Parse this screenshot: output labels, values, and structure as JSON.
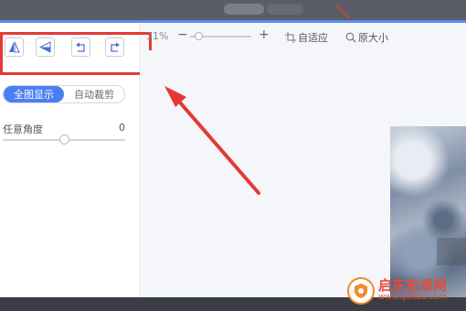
{
  "toolbar": {
    "tools": [
      {
        "icon": "flip-horizontal-icon"
      },
      {
        "icon": "flip-vertical-icon"
      },
      {
        "icon": "rotate-left-icon"
      },
      {
        "icon": "rotate-right-icon"
      }
    ]
  },
  "crop_mode": {
    "options": [
      "全图显示",
      "自动裁剪"
    ],
    "selected": "全图显示"
  },
  "angle": {
    "label": "任意角度",
    "value": "0",
    "slider_fraction": 0.5
  },
  "zoom": {
    "value": "31%",
    "minus": "−",
    "plus": "+",
    "slider_fraction": 0.1,
    "fit_label": "自适应",
    "original_label": "原大小"
  },
  "watermark": {
    "name": "启东安卓网",
    "url": "www.qdltdu.com"
  },
  "colors": {
    "accent": "#4c7ef3",
    "annotation": "#e53935"
  }
}
